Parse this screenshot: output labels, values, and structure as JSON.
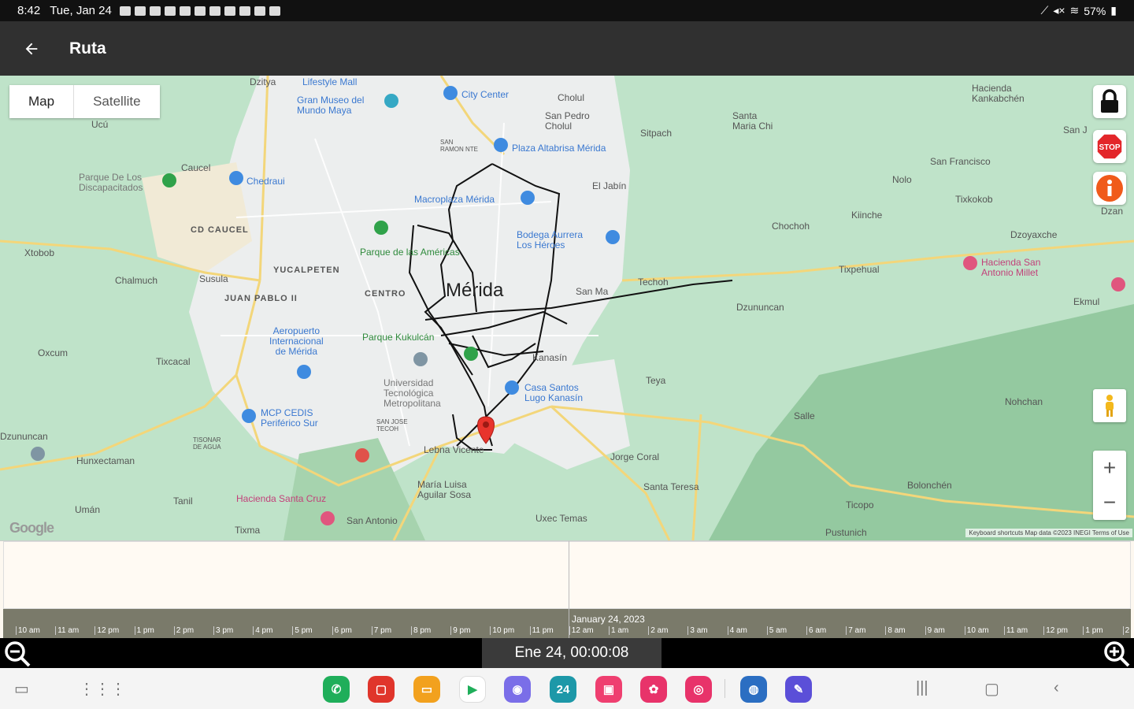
{
  "status_bar": {
    "time": "8:42",
    "date": "Tue, Jan 24",
    "battery": "57%"
  },
  "app_bar": {
    "title": "Ruta",
    "back_icon": "arrow-left-icon"
  },
  "map": {
    "type_control": {
      "map": "Map",
      "satellite": "Satellite"
    },
    "city": "Mérida",
    "labels": {
      "lifestyle_mall": "Lifestyle Mall",
      "gran_museo": "Gran Museo del\nMundo Maya",
      "city_center": "City Center",
      "cholul": "Cholul",
      "san_pedro_cholul": "San Pedro\nCholul",
      "santa_maria_chi": "Santa\nMaria Chi",
      "hacienda_kankabchen": "Hacienda\nKankabchén",
      "san_ramon_nte": "SAN\nRAMON NTE",
      "plaza_altabrisa": "Plaza Altabrisa Mérida",
      "sitpach": "Sitpach",
      "ucu": "Ucú",
      "caucel": "Caucel",
      "chedraui": "Chedraui",
      "parque_de_los_discapacitados": "Parque De Los\nDiscapacitados",
      "macroplaza": "Macroplaza Mérida",
      "el_jabin": "El Jabín",
      "san_francisco": "San Francisco",
      "nolo": "Nolo",
      "tixkokob": "Tixkokob",
      "cd_caucel": "CD CAUCEL",
      "parque_americas": "Parque de las Américas",
      "bodega_aurrera": "Bodega Aurrera\nLos Héroes",
      "chochoh": "Chochoh",
      "kiinche": "Kiinche",
      "xtobob": "Xtobob",
      "yucalpeten": "YUCALPETEN",
      "chalmuch": "Chalmuch",
      "susula": "Susula",
      "juan_pablo": "JUAN PABLO II",
      "centro": "CENTRO",
      "san_marcos": "San Ma",
      "techoh": "Techoh",
      "tixpehual": "Tixpehual",
      "hacienda_san_antonio": "Hacienda San\nAntonio Millet",
      "dzan": "Dzan",
      "ekmul": "Ekmul",
      "aeropuerto": "Aeropuerto\nInternacional\nde Mérida",
      "parque_kukulcan": "Parque Kukulcán",
      "oxcum": "Oxcum",
      "tixcacal": "Tixcacal",
      "kanasin": "Kanasín",
      "teya": "Teya",
      "casa_santos": "Casa Santos\nLugo Kanasín",
      "mcp_cedis": "MCP CEDIS\nPeriférico Sur",
      "universidad": "Universidad\nTecnológica\nMetropolitana",
      "dzununcan": "Dzununcan",
      "san_jose_tecoh": "SAN JOSE\nTECOH",
      "salle": "Salle",
      "nohchan": "Nohchan",
      "dzoyaxche": "Dzoyaxche",
      "tisonar": "TISONAR\nDE AGUA",
      "hunxectaman": "Hunxectaman",
      "tamanche_v": "Lebna Vicente",
      "jorge_coral": "Jorge Coral",
      "maria_luisa": "María Luisa\nAguilar Sosa",
      "santa_teresa": "Santa Teresa",
      "bolonchen": "Bolonchén",
      "tanil": "Tanil",
      "hacienda_santa_cruz": "Hacienda Santa Cruz",
      "uman": "Umán",
      "ticopo": "Ticopo",
      "uxec_temas": "Uxec Temas",
      "san_antonio": "San Antonio",
      "tiuma": "Tixma",
      "pustunich": "Pustunich",
      "sitilpech": "San J"
    },
    "google_logo": "Google",
    "attribution": "Keyboard shortcuts   Map data ©2023 INEGI   Terms of Use",
    "side_buttons": {
      "lock": "lock-icon",
      "stop": "STOP",
      "info": "i"
    }
  },
  "timeline": {
    "date_label": "January 24, 2023",
    "ticks": [
      "10 am",
      "11 am",
      "12 pm",
      "1 pm",
      "2 pm",
      "3 pm",
      "4 pm",
      "5 pm",
      "6 pm",
      "7 pm",
      "8 pm",
      "9 pm",
      "10 pm",
      "11 pm",
      "12 am",
      "1 am",
      "2 am",
      "3 am",
      "4 am",
      "5 am",
      "6 am",
      "7 am",
      "8 am",
      "9 am",
      "10 am",
      "11 am",
      "12 pm",
      "1 pm",
      "2"
    ],
    "current_time": "Ene 24, 00:00:08"
  },
  "nav_bar": {
    "apps": [
      {
        "name": "phone-app",
        "glyph": "✆",
        "color": "#1fae5a"
      },
      {
        "name": "notes-red-app",
        "glyph": "▢",
        "color": "#e0352b"
      },
      {
        "name": "files-app",
        "glyph": "▭",
        "color": "#f2a11e"
      },
      {
        "name": "play-store-app",
        "glyph": "▶",
        "color": "#ffffff"
      },
      {
        "name": "messages-app",
        "glyph": "◉",
        "color": "#7a6ee8"
      },
      {
        "name": "calendar-app",
        "glyph": "24",
        "color": "#1d98a8"
      },
      {
        "name": "galaxy-store-app",
        "glyph": "▣",
        "color": "#ef3f70"
      },
      {
        "name": "flower-app",
        "glyph": "✿",
        "color": "#e8336a"
      },
      {
        "name": "camera-app",
        "glyph": "◎",
        "color": "#e8336a"
      },
      {
        "name": "browser-app",
        "glyph": "◍",
        "color": "#2b6ec2"
      },
      {
        "name": "pen-app",
        "glyph": "✎",
        "color": "#5b4fd8"
      }
    ]
  }
}
